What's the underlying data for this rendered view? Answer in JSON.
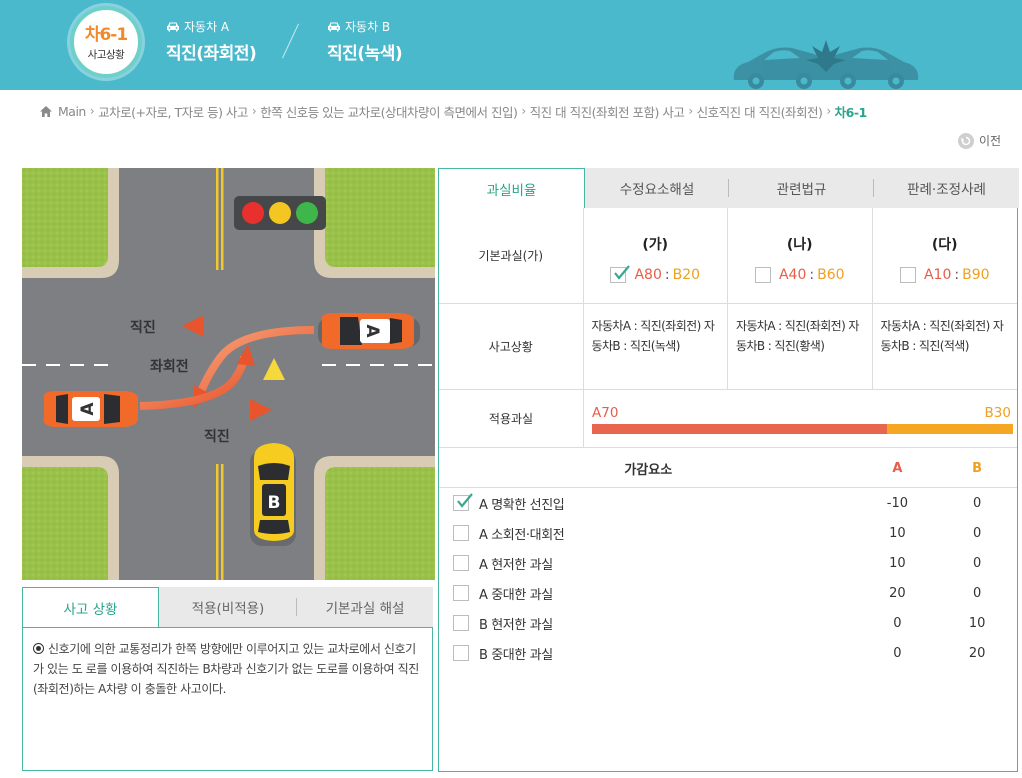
{
  "header": {
    "case_code": "차6-1",
    "case_sub": "사고상황",
    "car_a_label": "자동차 A",
    "car_a_value": "직진(좌회전)",
    "car_b_label": "자동차 B",
    "car_b_value": "직진(녹색)",
    "bg_color": "#4bb9cc"
  },
  "breadcrumb": {
    "items": [
      "Main",
      "교차로(+자로, T자로 등) 사고",
      "한쪽 신호등 있는 교차로(상대차량이 측면에서 진입)",
      "직진 대 직진(좌회전 포함) 사고",
      "신호직진 대 직진(좌회전)"
    ],
    "current": "차6-1",
    "back_label": "이전"
  },
  "scene": {
    "labels": {
      "straight_top": "직진",
      "left_turn": "좌회전",
      "straight_bottom": "직진"
    },
    "car_a": "A",
    "car_b": "B",
    "signal_lights": [
      "#e8312e",
      "#f4c622",
      "#3eb649"
    ]
  },
  "info_tabs": {
    "tabs": [
      "사고 상황",
      "적용(비적용)",
      "기본과실 해설"
    ],
    "active": 0,
    "body": "신호기에 의한 교통정리가 한쪽 방향에만 이루어지고 있는 교차로에서 신호기가 있는 도 로를 이용하여 직진하는 B차량과 신호기가 없는 도로를 이용하여 직진(좌회전)하는 A차량 이 충돌한 사고이다."
  },
  "right_tabs": {
    "tabs": [
      "과실비율",
      "수정요소해설",
      "관련법규",
      "판례·조정사례"
    ],
    "active": 0
  },
  "fault": {
    "basic_label": "기본과실(가)",
    "situation_label": "사고상황",
    "applied_label": "적용과실",
    "options": [
      {
        "name": "(가)",
        "a": "A80",
        "b": "B20",
        "checked": true,
        "situation": "자동차A : 직진(좌회전) 자동차B : 직진(녹색)"
      },
      {
        "name": "(나)",
        "a": "A40",
        "b": "B60",
        "checked": false,
        "situation": "자동차A : 직진(좌회전) 자동차B : 직진(황색)"
      },
      {
        "name": "(다)",
        "a": "A10",
        "b": "B90",
        "checked": false,
        "situation": "자동차A : 직진(좌회전) 자동차B : 직진(적색)"
      }
    ],
    "applied": {
      "a_label": "A70",
      "b_label": "B30",
      "a_value": 70,
      "b_value": 30
    }
  },
  "adjust": {
    "title": "가감요소",
    "col_a": "A",
    "col_b": "B",
    "rows": [
      {
        "label": "A 명확한 선진입",
        "a": "-10",
        "b": "0",
        "checked": true
      },
      {
        "label": "A 소회전·대회전",
        "a": "10",
        "b": "0",
        "checked": false
      },
      {
        "label": "A 현저한 과실",
        "a": "10",
        "b": "0",
        "checked": false
      },
      {
        "label": "A 중대한 과실",
        "a": "20",
        "b": "0",
        "checked": false
      },
      {
        "label": "B 현저한 과실",
        "a": "0",
        "b": "10",
        "checked": false
      },
      {
        "label": "B 중대한 과실",
        "a": "0",
        "b": "20",
        "checked": false
      }
    ]
  }
}
